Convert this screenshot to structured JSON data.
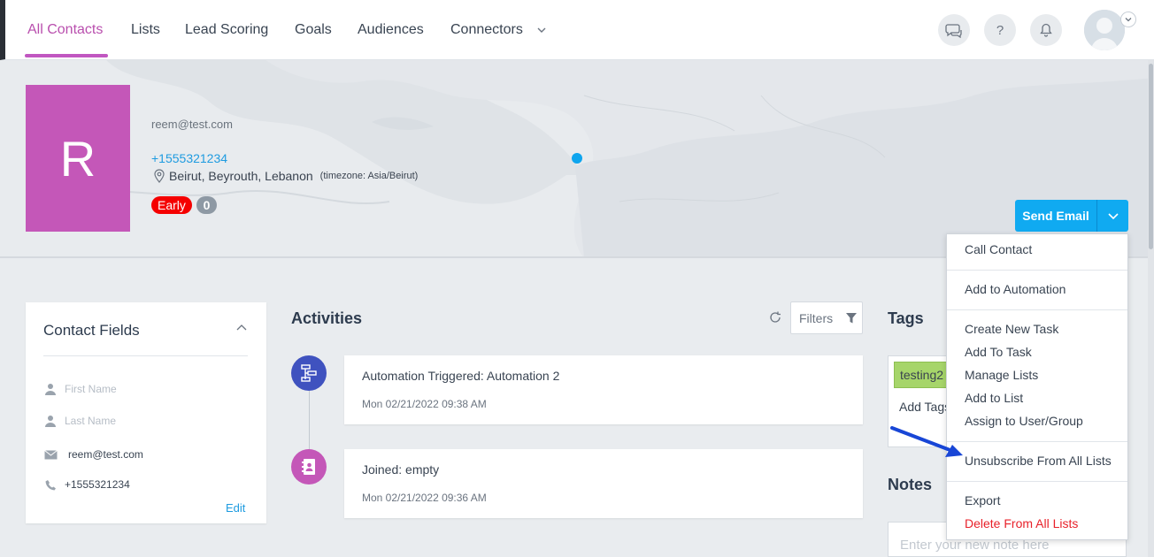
{
  "nav": {
    "tabs": [
      {
        "label": "All Contacts",
        "active": true
      },
      {
        "label": "Lists"
      },
      {
        "label": "Lead Scoring"
      },
      {
        "label": "Goals"
      },
      {
        "label": "Audiences"
      },
      {
        "label": "Connectors"
      }
    ],
    "icons": [
      "chat-icon",
      "help-icon",
      "bell-icon"
    ],
    "accent_color": "#b94fae"
  },
  "contact": {
    "initial": "R",
    "email": "reem@test.com",
    "phone": "+1555321234",
    "location": "Beirut, Beyrouth, Lebanon",
    "timezone": "(timezone: Asia/Beirut)",
    "badge_early": "Early",
    "badge_count": "0",
    "avatar_color": "#c457b8"
  },
  "send_email": {
    "label": "Send Email",
    "color": "#10aaf1"
  },
  "contact_fields": {
    "title": "Contact Fields",
    "first_name_placeholder": "First Name",
    "last_name_placeholder": "Last Name",
    "email": "reem@test.com",
    "phone": "+1555321234",
    "edit": "Edit"
  },
  "activities": {
    "title": "Activities",
    "filters": "Filters",
    "items": [
      {
        "title": "Automation Triggered: Automation 2",
        "date": "Mon 02/21/2022 09:38 AM",
        "icon": "automation-icon",
        "color": "#3f52bf"
      },
      {
        "title": "Joined: empty",
        "date": "Mon 02/21/2022 09:36 AM",
        "icon": "contact-book-icon",
        "color": "#c457b8"
      }
    ]
  },
  "tags": {
    "title": "Tags",
    "items": [
      "testing2"
    ],
    "add_label": "Add Tags"
  },
  "notes": {
    "title": "Notes",
    "placeholder": "Enter your new note here"
  },
  "menu": {
    "groups": [
      [
        "Call Contact"
      ],
      [
        "Add to Automation"
      ],
      [
        "Create New Task",
        "Add To Task",
        "Manage Lists",
        "Add to List",
        "Assign to User/Group"
      ],
      [
        "Unsubscribe From All Lists"
      ],
      [
        "Export",
        "Delete From All Lists"
      ]
    ],
    "danger_color": "#e8212a"
  }
}
